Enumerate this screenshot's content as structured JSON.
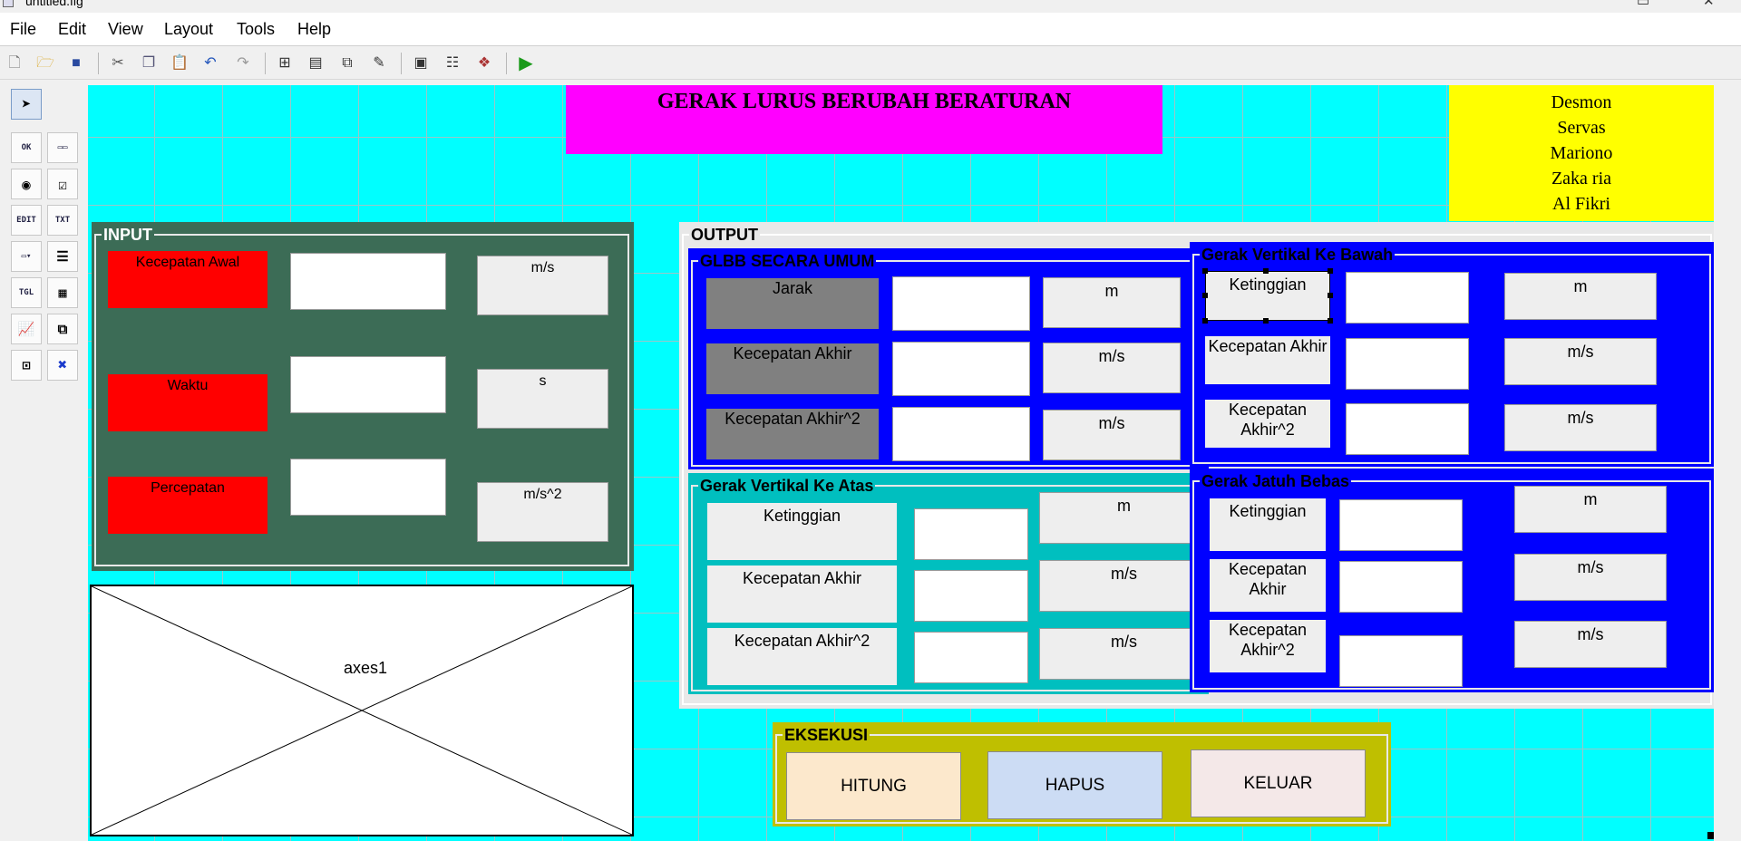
{
  "window": {
    "title": "untitled.fig"
  },
  "menubar": {
    "items": [
      "File",
      "Edit",
      "View",
      "Layout",
      "Tools",
      "Help"
    ]
  },
  "header": {
    "title": "GERAK LURUS BERUBAH BERATURAN",
    "names": [
      "Desmon",
      "Servas",
      "Mariono",
      "Zaka ria",
      "Al Fikri"
    ]
  },
  "input": {
    "title": "INPUT",
    "rows": [
      {
        "label": "Kecepatan Awal",
        "unit": "m/s"
      },
      {
        "label": "Waktu",
        "unit": "s"
      },
      {
        "label": "Percepatan",
        "unit": "m/s^2"
      }
    ]
  },
  "axes": {
    "label": "axes1"
  },
  "output": {
    "title": "OUTPUT",
    "glbb": {
      "title": "GLBB SECARA UMUM",
      "rows": [
        {
          "label": "Jarak",
          "unit": "m"
        },
        {
          "label": "Kecepatan Akhir",
          "unit": "m/s"
        },
        {
          "label": "Kecepatan Akhir^2",
          "unit": "m/s"
        }
      ]
    },
    "vertical_down": {
      "title": "Gerak Vertikal Ke Bawah",
      "rows": [
        {
          "label": "Ketinggian",
          "unit": "m"
        },
        {
          "label": "Kecepatan Akhir",
          "unit": "m/s"
        },
        {
          "label": "Kecepatan Akhir^2",
          "unit": "m/s"
        }
      ]
    },
    "vertical_up": {
      "title": "Gerak Vertikal Ke Atas",
      "rows": [
        {
          "label": "Ketinggian",
          "unit": "m"
        },
        {
          "label": "Kecepatan Akhir",
          "unit": "m/s"
        },
        {
          "label": "Kecepatan Akhir^2",
          "unit": "m/s"
        }
      ]
    },
    "free_fall": {
      "title": "Gerak Jatuh Bebas",
      "rows": [
        {
          "label": "Ketinggian",
          "unit": "m"
        },
        {
          "label": "Kecepatan Akhir",
          "unit": "m/s"
        },
        {
          "label": "Kecepatan Akhir^2",
          "unit": "m/s"
        }
      ]
    }
  },
  "execute": {
    "title": "EKSEKUSI",
    "buttons": [
      "HITUNG",
      "HAPUS",
      "KELUAR"
    ]
  },
  "palette": {
    "icons": [
      "select-tool-icon",
      "push-button-icon",
      "slider-icon",
      "radio-button-icon",
      "checkbox-icon",
      "edit-text-icon",
      "static-text-icon",
      "popup-menu-icon",
      "listbox-icon",
      "toggle-button-icon",
      "table-icon",
      "axes-icon",
      "panel-icon",
      "button-group-icon",
      "activex-icon"
    ]
  },
  "colors": {
    "canvas": "#00ffff",
    "title_bg": "#ff00ff",
    "names_bg": "#ffff00",
    "input_panel": "#3c6c56",
    "input_label": "#ff0000",
    "blue_panel": "#0000ff",
    "teal_panel": "#00bfbf",
    "execute_panel": "#bfbf00",
    "hitung": "#fce8cc",
    "hapus": "#ccdcf4",
    "keluar": "#f4e8e8"
  }
}
